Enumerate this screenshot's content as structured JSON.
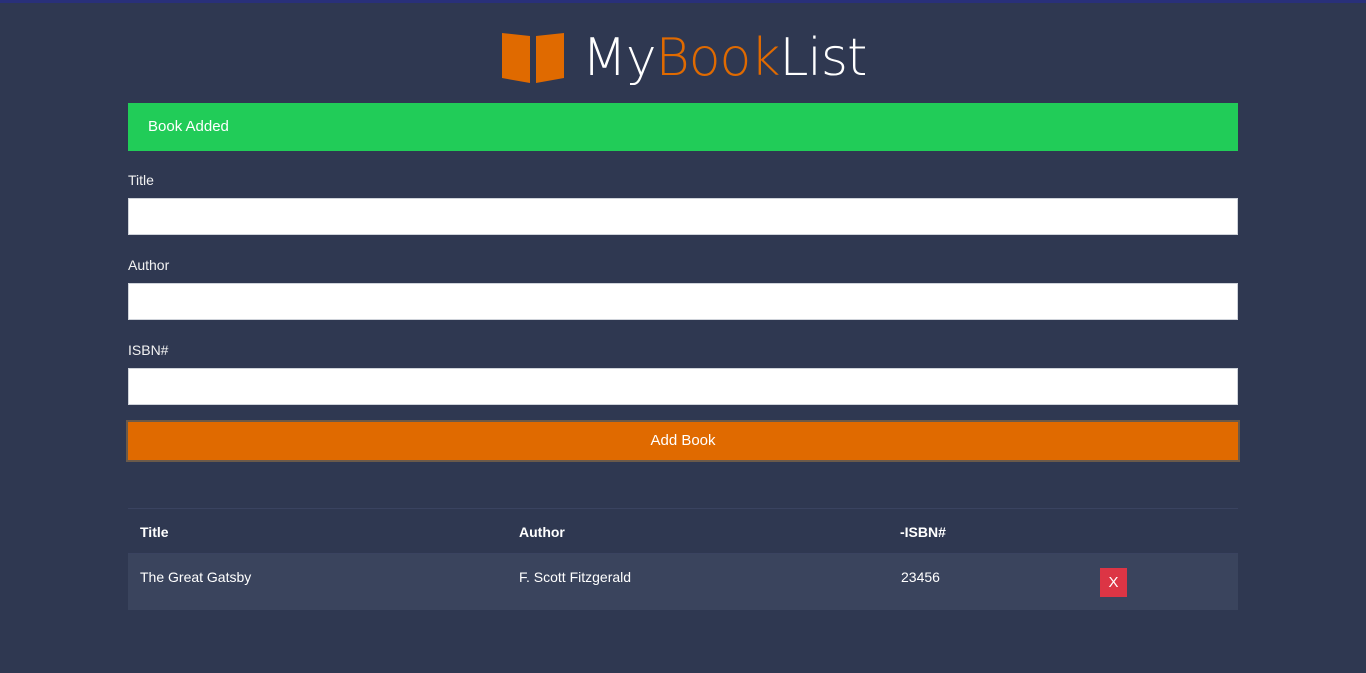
{
  "logo": {
    "part_my": "My",
    "part_book": "Book",
    "part_list": "List",
    "accent_color": "#e06a00",
    "icon": "open-book-icon"
  },
  "alert": {
    "message": "Book Added",
    "color": "#21cc58"
  },
  "form": {
    "title_label": "Title",
    "title_value": "",
    "author_label": "Author",
    "author_value": "",
    "isbn_label": "ISBN#",
    "isbn_value": "",
    "submit_label": "Add Book"
  },
  "table": {
    "headers": [
      "Title",
      "Author",
      "-ISBN#"
    ],
    "rows": [
      {
        "title": "The Great Gatsby",
        "author": "F. Scott Fitzgerald",
        "isbn": "23456",
        "delete_label": "X"
      }
    ]
  },
  "colors": {
    "background": "#2f3851",
    "button": "#e06a00",
    "delete": "#dc3545"
  }
}
